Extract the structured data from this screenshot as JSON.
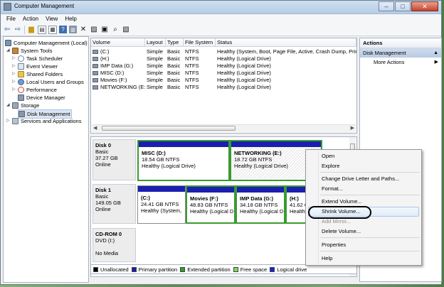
{
  "window": {
    "title": "Computer Management"
  },
  "menubar": [
    "File",
    "Action",
    "View",
    "Help"
  ],
  "toolbar": {
    "icons": [
      "back-arrow-icon",
      "forward-arrow-icon",
      "up-folder-icon",
      "show-tree-icon",
      "properties-icon",
      "help-icon",
      "show-hide-icon",
      "delete-icon",
      "properties2-icon",
      "rescan-icon",
      "magnify-icon",
      "format-icon"
    ]
  },
  "tree": {
    "root": "Computer Management (Local)",
    "system_tools": "System Tools",
    "items": [
      "Task Scheduler",
      "Event Viewer",
      "Shared Folders",
      "Local Users and Groups",
      "Performance",
      "Device Manager"
    ],
    "storage": "Storage",
    "disk_management": "Disk Management",
    "services": "Services and Applications"
  },
  "volume_list": {
    "headers": [
      "Volume",
      "Layout",
      "Type",
      "File System",
      "Status"
    ],
    "rows": [
      [
        "(C:)",
        "Simple",
        "Basic",
        "NTFS",
        "Healthy (System, Boot, Page File, Active, Crash Dump, Prim"
      ],
      [
        "(H:)",
        "Simple",
        "Basic",
        "NTFS",
        "Healthy (Logical Drive)"
      ],
      [
        "IMP Data (G:)",
        "Simple",
        "Basic",
        "NTFS",
        "Healthy (Logical Drive)"
      ],
      [
        "MISC (D:)",
        "Simple",
        "Basic",
        "NTFS",
        "Healthy (Logical Drive)"
      ],
      [
        "Movies (F:)",
        "Simple",
        "Basic",
        "NTFS",
        "Healthy (Logical Drive)"
      ],
      [
        "NETWORKING (E:)",
        "Simple",
        "Basic",
        "NTFS",
        "Healthy (Logical Drive)"
      ]
    ]
  },
  "disks": {
    "disk0": {
      "name": "Disk 0",
      "type": "Basic",
      "size": "37.27 GB",
      "status": "Online",
      "parts": [
        {
          "name": "MISC  (D:)",
          "size": "18.54 GB NTFS",
          "status": "Healthy (Logical Drive)"
        },
        {
          "name": "NETWORKING  (E:)",
          "size": "18.72 GB NTFS",
          "status": "Healthy (Logical Drive)"
        }
      ]
    },
    "disk1": {
      "name": "Disk 1",
      "type": "Basic",
      "size": "149.05 GB",
      "status": "Online",
      "parts": [
        {
          "name": "(C:)",
          "size": "24.41 GB NTFS",
          "status": "Healthy (System,"
        },
        {
          "name": "Movies  (F:)",
          "size": "48.83 GB NTFS",
          "status": "Healthy (Logical D"
        },
        {
          "name": "IMP Data  (G:)",
          "size": "34.18 GB NTFS",
          "status": "Healthy (Logical D"
        },
        {
          "name": "(H:)",
          "size": "41.62 GB",
          "status": "Healthy ("
        }
      ]
    },
    "cdrom0": {
      "name": "CD-ROM 0",
      "type": "DVD (I:)",
      "status": "No Media"
    }
  },
  "legend": [
    {
      "label": "Unallocated",
      "color": "#000000"
    },
    {
      "label": "Primary partition",
      "color": "#1b1fb0"
    },
    {
      "label": "Extended partition",
      "color": "#3a9a32"
    },
    {
      "label": "Free space",
      "color": "#7ed957"
    },
    {
      "label": "Logical drive",
      "color": "#1b1fd8"
    }
  ],
  "actions": {
    "title": "Actions",
    "section": "Disk Management",
    "more": "More Actions"
  },
  "context_menu": {
    "items": [
      "Open",
      "Explore",
      "Change Drive Letter and Paths...",
      "Format...",
      "Extend Volume...",
      "Shrink Volume...",
      "Add Mirror...",
      "Delete Volume...",
      "Properties",
      "Help"
    ],
    "highlighted": "Shrink Volume...",
    "disabled": [
      "Add Mirror..."
    ]
  }
}
